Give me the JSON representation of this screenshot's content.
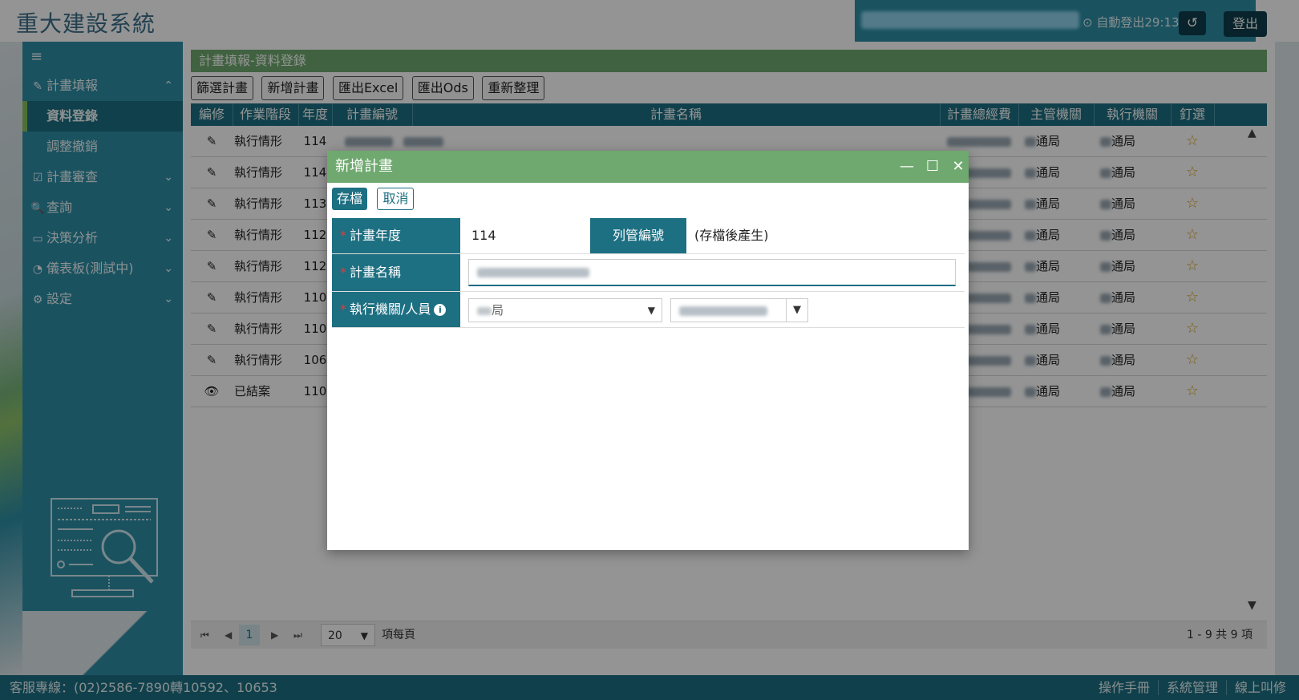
{
  "app": {
    "title": "重大建設系統"
  },
  "user": {
    "auto_logout": "⊙ 自動登出29:13",
    "refresh_icon": "↺",
    "logout_label": "登出"
  },
  "sidebar": {
    "toggle_icon": "≡",
    "items": [
      {
        "icon": "✎",
        "label": "計畫填報",
        "chevron": "⌃"
      },
      {
        "label": "資料登錄"
      },
      {
        "label": "調整撤銷"
      },
      {
        "icon": "☑",
        "label": "計畫審查",
        "chevron": "⌄"
      },
      {
        "icon": "🔍",
        "label": "查詢",
        "chevron": "⌄"
      },
      {
        "icon": "▭",
        "label": "決策分析",
        "chevron": "⌄"
      },
      {
        "icon": "◔",
        "label": "儀表板(測試中)",
        "chevron": "⌄"
      },
      {
        "icon": "⚙",
        "label": "設定",
        "chevron": "⌄"
      }
    ]
  },
  "main": {
    "breadcrumb": "計畫填報-資料登錄",
    "toolbar": [
      "篩選計畫",
      "新增計畫",
      "匯出Excel",
      "匯出Ods",
      "重新整理"
    ],
    "columns": [
      "編修",
      "作業階段",
      "年度",
      "計畫編號",
      "計畫名稱",
      "計畫總經費",
      "主管機關",
      "執行機關",
      "釘選"
    ],
    "rows": [
      {
        "edit": "✎",
        "stage": "執行情形",
        "year": "114",
        "org": "通局",
        "exec": "通局",
        "pin": "☆"
      },
      {
        "edit": "✎",
        "stage": "執行情形",
        "year": "114",
        "org": "通局",
        "exec": "通局",
        "pin": "☆"
      },
      {
        "edit": "✎",
        "stage": "執行情形",
        "year": "113",
        "org": "通局",
        "exec": "通局",
        "pin": "☆"
      },
      {
        "edit": "✎",
        "stage": "執行情形",
        "year": "112",
        "org": "通局",
        "exec": "通局",
        "pin": "☆"
      },
      {
        "edit": "✎",
        "stage": "執行情形",
        "year": "112",
        "org": "通局",
        "exec": "通局",
        "pin": "☆"
      },
      {
        "edit": "✎",
        "stage": "執行情形",
        "year": "110",
        "org": "通局",
        "exec": "通局",
        "pin": "☆"
      },
      {
        "edit": "✎",
        "stage": "執行情形",
        "year": "110",
        "org": "通局",
        "exec": "通局",
        "pin": "☆"
      },
      {
        "edit": "✎",
        "stage": "執行情形",
        "year": "106",
        "org": "通局",
        "exec": "通局",
        "pin": "☆"
      },
      {
        "edit": "👁",
        "stage": "已結案",
        "year": "110",
        "org": "通局",
        "exec": "通局",
        "pin": "☆"
      }
    ],
    "pager": {
      "first": "⏮",
      "prev": "◀",
      "page": "1",
      "next": "▶",
      "last": "⏭",
      "page_size": "20",
      "page_size_label": "項每頁",
      "summary": "1 - 9 共 9 項"
    }
  },
  "footer": {
    "hotline": "客服專線：(02)2586-7890轉10592、10653",
    "links": [
      "操作手冊",
      "系統管理",
      "線上叫修"
    ]
  },
  "modal": {
    "title": "新增計畫",
    "controls": {
      "minimize": "—",
      "maximize": "☐",
      "close": "✕"
    },
    "save_label": "存檔",
    "cancel_label": "取消",
    "fields": {
      "year_label": "計畫年度",
      "year_value": "114",
      "control_no_label": "列管編號",
      "control_no_value": "(存檔後產生)",
      "name_label": "計畫名稱",
      "exec_label": "執行機關/人員",
      "exec_org_value": "局",
      "required_mark": "*",
      "info_icon": "i"
    }
  },
  "colors": {
    "teal": "#2d8ea5",
    "dark_teal": "#1d6f82",
    "green": "#6fa96f",
    "star": "#d9a21a",
    "required": "#e23b3b"
  }
}
